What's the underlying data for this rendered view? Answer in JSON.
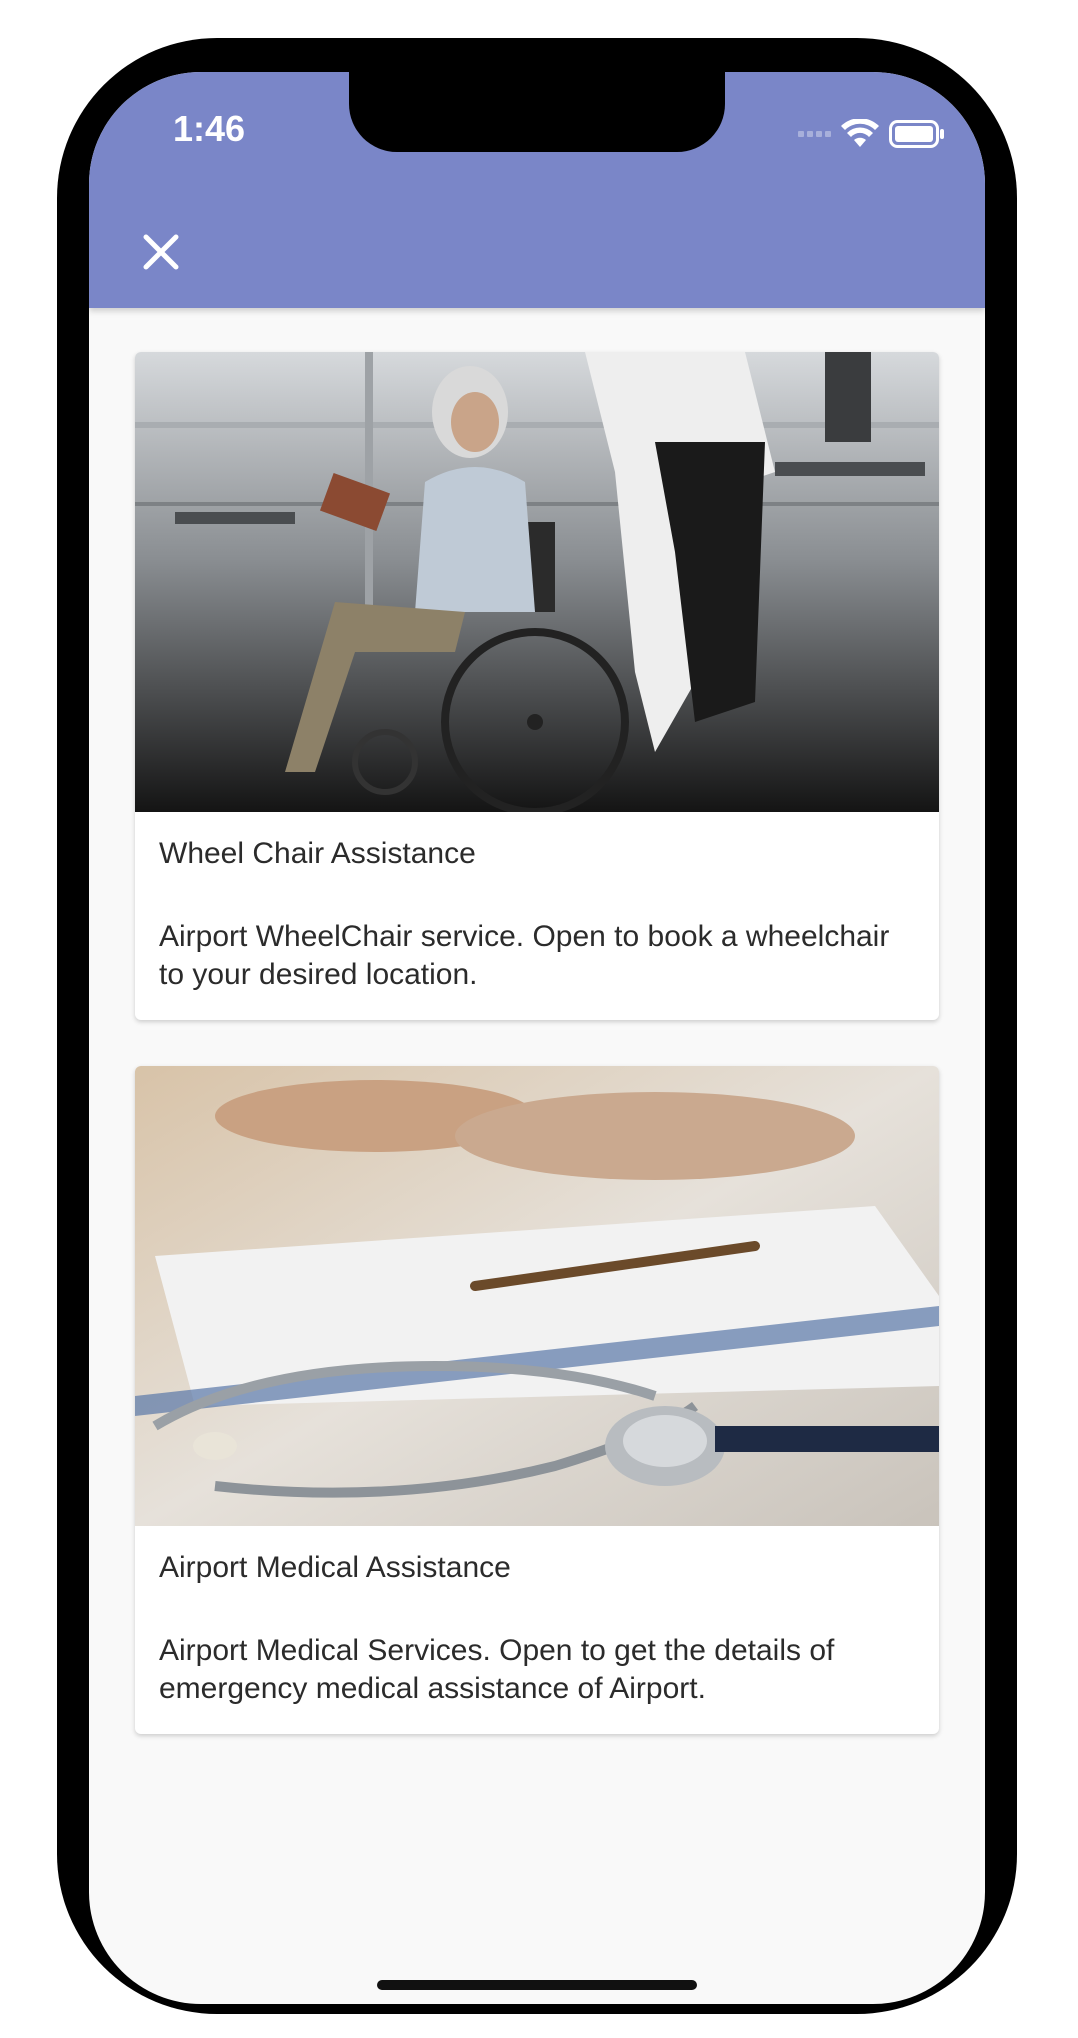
{
  "status_bar": {
    "time": "1:46",
    "icons": [
      "signal-icon",
      "wifi-icon",
      "battery-icon"
    ]
  },
  "app_bar": {
    "color": "#7a86c8",
    "close_icon": "close-icon"
  },
  "cards": [
    {
      "title": "Wheel Chair Assistance",
      "description": "Airport WheelChair service. Open to book a wheelchair to your desired location.",
      "image_alt": "wheelchair photo"
    },
    {
      "title": "Airport Medical Assistance",
      "description": "Airport Medical Services. Open to get the details of emergency medical assistance of Airport.",
      "image_alt": "stethoscope photo"
    }
  ]
}
